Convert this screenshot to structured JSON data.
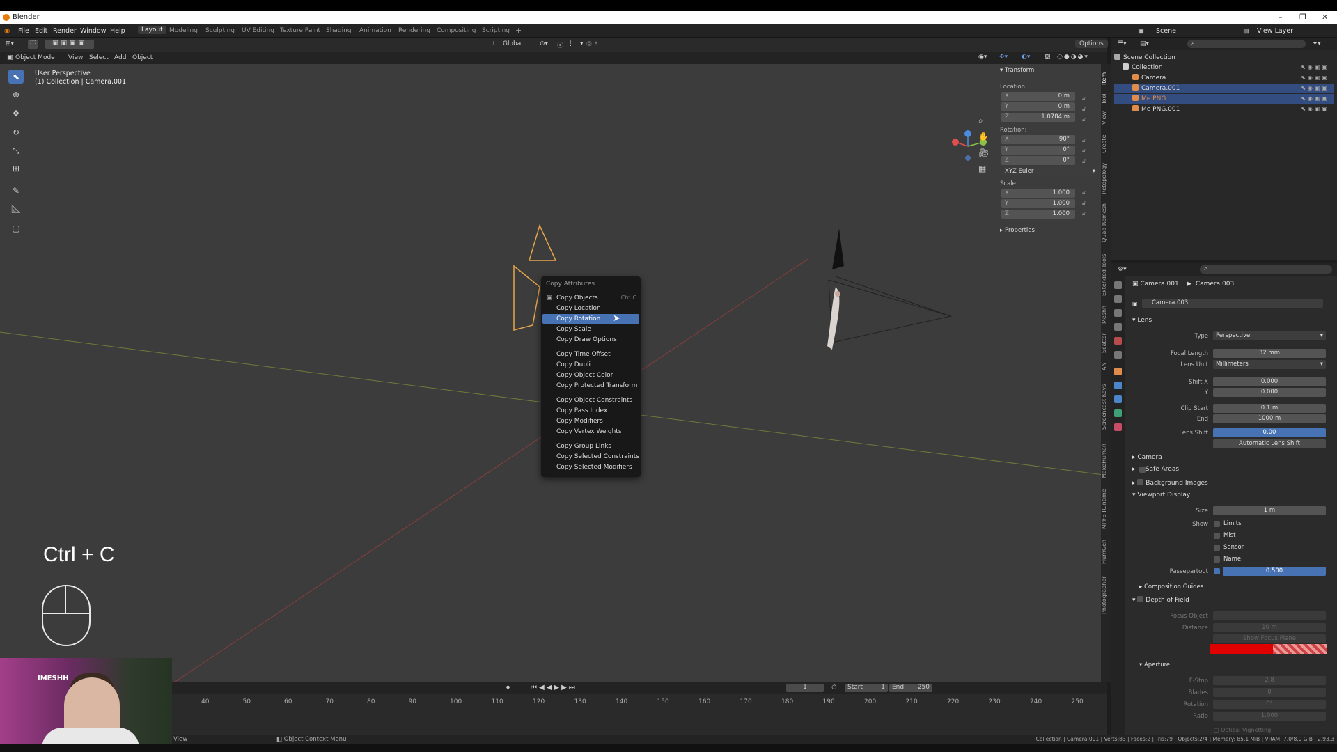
{
  "window": {
    "title": "Blender"
  },
  "menu": {
    "items": [
      "File",
      "Edit",
      "Render",
      "Window",
      "Help"
    ]
  },
  "workspaces": [
    "Layout",
    "Modeling",
    "Sculpting",
    "UV Editing",
    "Texture Paint",
    "Shading",
    "Animation",
    "Rendering",
    "Compositing",
    "Scripting"
  ],
  "toolheader": {
    "orientation": "Global",
    "options": "Options"
  },
  "viewport_header": {
    "mode": "Object Mode",
    "menus": [
      "View",
      "Select",
      "Add",
      "Object"
    ]
  },
  "viewport": {
    "perspective": "User Perspective",
    "collection": "(1) Collection | Camera.001"
  },
  "npanel": {
    "title": "Transform",
    "location_label": "Location:",
    "location": [
      {
        "ax": "X",
        "val": "0 m"
      },
      {
        "ax": "Y",
        "val": "0 m"
      },
      {
        "ax": "Z",
        "val": "1.0784 m"
      }
    ],
    "rotation_label": "Rotation:",
    "rotation": [
      {
        "ax": "X",
        "val": "90°"
      },
      {
        "ax": "Y",
        "val": "0°"
      },
      {
        "ax": "Z",
        "val": "0°"
      }
    ],
    "rotation_mode": "XYZ Euler",
    "scale_label": "Scale:",
    "scale": [
      {
        "ax": "X",
        "val": "1.000"
      },
      {
        "ax": "Y",
        "val": "1.000"
      },
      {
        "ax": "Z",
        "val": "1.000"
      }
    ],
    "properties": "Properties"
  },
  "vtabs": [
    "Item",
    "Tool",
    "View",
    "Create",
    "Retopology",
    "Quad Remesh",
    "Extended Tools",
    "Meshh",
    "Scatter",
    "AN",
    "Screencast Keys",
    "MakeHuman",
    "MPFB Runtime",
    "HumGen",
    "Photographer"
  ],
  "context_menu": {
    "title": "Copy Attributes",
    "items": [
      {
        "label": "Copy Objects",
        "shortcut": "Ctrl C"
      },
      {
        "label": "Copy Location",
        "shortcut": ""
      },
      {
        "label": "Copy Rotation",
        "shortcut": "",
        "highlighted": true
      },
      {
        "label": "Copy Scale",
        "shortcut": ""
      },
      {
        "label": "Copy Draw Options",
        "shortcut": ""
      },
      {
        "label": "Copy Time Offset",
        "shortcut": ""
      },
      {
        "label": "Copy Dupli",
        "shortcut": ""
      },
      {
        "label": "Copy Object Color",
        "shortcut": ""
      },
      {
        "label": "Copy Protected Transform",
        "shortcut": ""
      },
      {
        "label": "Copy Object Constraints",
        "shortcut": ""
      },
      {
        "label": "Copy Pass Index",
        "shortcut": ""
      },
      {
        "label": "Copy Modifiers",
        "shortcut": ""
      },
      {
        "label": "Copy Vertex Weights",
        "shortcut": ""
      },
      {
        "label": "Copy Group Links",
        "shortcut": ""
      },
      {
        "label": "Copy Selected Constraints",
        "shortcut": ""
      },
      {
        "label": "Copy Selected Modifiers",
        "shortcut": ""
      }
    ]
  },
  "overlay": {
    "keys": "Ctrl + C"
  },
  "webcam": {
    "logo": "IMESHH"
  },
  "timeline": {
    "ticks": [
      "40",
      "50",
      "60",
      "70",
      "80",
      "90",
      "100",
      "110",
      "120",
      "130",
      "140",
      "150",
      "160",
      "170",
      "180",
      "190",
      "200",
      "210",
      "220",
      "230",
      "240",
      "250"
    ],
    "current_frame": "1",
    "start_label": "Start",
    "start": "1",
    "end_label": "End",
    "end": "250"
  },
  "status": {
    "left": "View",
    "context": "Object Context Menu",
    "right": "Collection | Camera.001 | Verts:83 | Faces:2 | Tris:79 | Objects:2/4 | Memory: 85.1 MiB | VRAM: 7.0/8.0 GiB | 2.93.3"
  },
  "outliner": {
    "scene": "Scene",
    "view_layer": "View Layer",
    "root": "Scene Collection",
    "rows": [
      {
        "label": "Collection",
        "color": "#cfcfcf",
        "selected": false,
        "indent": 0
      },
      {
        "label": "Camera",
        "color": "#e08c4a",
        "selected": false,
        "indent": 1
      },
      {
        "label": "Camera.001",
        "color": "#e08c4a",
        "selected": true,
        "indent": 1
      },
      {
        "label": "Me PNG",
        "color": "#e08c4a",
        "selected": true,
        "indent": 1
      },
      {
        "label": "Me PNG.001",
        "color": "#e08c4a",
        "selected": false,
        "indent": 1
      }
    ]
  },
  "properties": {
    "object": "Camera.001",
    "data": "Camera.003",
    "datablock": "Camera.003",
    "lens_section": "Lens",
    "type_label": "Type",
    "type": "Perspective",
    "focal_label": "Focal Length",
    "focal": "32 mm",
    "lens_unit_label": "Lens Unit",
    "lens_unit": "Millimeters",
    "shift_x_label": "Shift X",
    "shift_x": "0.000",
    "shift_y_label": "Y",
    "shift_y": "0.000",
    "clip_start_label": "Clip Start",
    "clip_start": "0.1 m",
    "clip_end_label": "End",
    "clip_end": "1000 m",
    "lens_shift_label": "Lens Shift",
    "lens_shift": "0.00",
    "auto_shift": "Automatic Lens Shift",
    "camera_section": "Camera",
    "safe_areas": "Safe Areas",
    "bg_images": "Background Images",
    "viewport_display": "Viewport Display",
    "size_label": "Size",
    "size": "1 m",
    "show_label": "Show",
    "show_opts": [
      "Limits",
      "Mist",
      "Sensor",
      "Name"
    ],
    "passepartout_label": "Passepartout",
    "passepartout": "0.500",
    "comp_guides": "Composition Guides",
    "dof": "Depth of Field",
    "focus_obj_label": "Focus Object",
    "distance_label": "Distance",
    "distance": "10 m",
    "show_focus_plane": "Show Focus Plane",
    "aperture": "Aperture",
    "fstop_label": "F-Stop",
    "fstop": "2.8",
    "blades_label": "Blades",
    "blades": "0",
    "rotation_label": "Rotation",
    "rotation": "0°",
    "ratio_label": "Ratio",
    "ratio": "1.000",
    "optical_vignetting": "Optical Vignetting"
  },
  "colors": {
    "accent": "#4772b3",
    "focus_plane": "#e00000",
    "selected_orange": "#e08c4a"
  }
}
